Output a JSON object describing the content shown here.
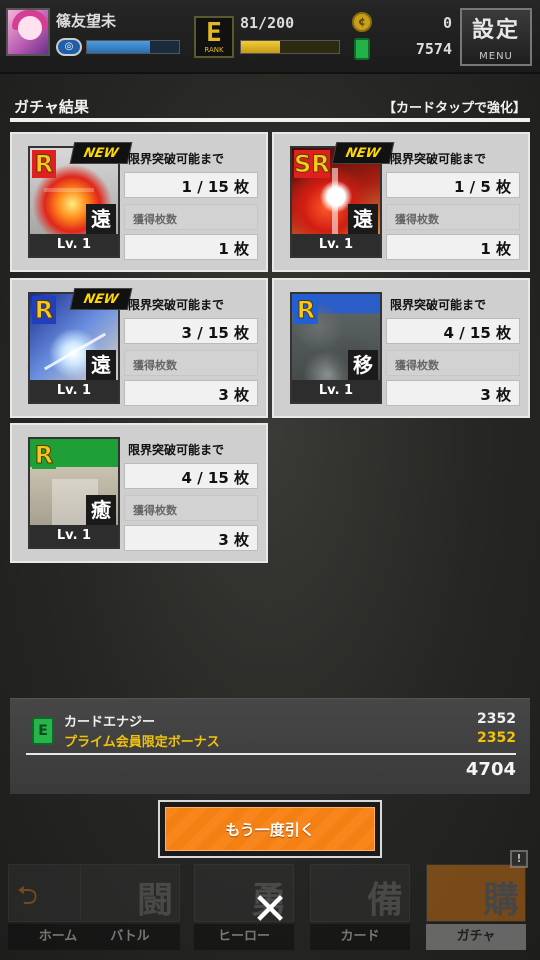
{
  "header": {
    "player_name": "篠友望未",
    "rank_letter": "E",
    "rank_label": "RANK",
    "stamina": "81/200",
    "stamina_fraction": 0.4,
    "exp_fraction": 0.68,
    "gems": "0",
    "energy": "7574",
    "settings_label": "設定",
    "settings_sub": "MENU"
  },
  "page": {
    "title": "ガチャ結果",
    "hint": "【カードタップで強化】"
  },
  "cards": [
    {
      "rarity": "R",
      "rarity_color": "#e02020",
      "new_label": "NEW",
      "type": "遠",
      "level": "Lv. 1",
      "limit_label": "限界突破可能まで",
      "limit_value": "1 / 15 枚",
      "owned_label": "獲得枚数",
      "owned_value": "1 枚"
    },
    {
      "rarity": "SR",
      "rarity_color": "#e02020",
      "new_label": "NEW",
      "type": "遠",
      "level": "Lv. 1",
      "limit_label": "限界突破可能まで",
      "limit_value": "1 / 5 枚",
      "owned_label": "獲得枚数",
      "owned_value": "1 枚"
    },
    {
      "rarity": "R",
      "rarity_color": "#1f3fbf",
      "new_label": "NEW",
      "type": "遠",
      "level": "Lv. 1",
      "limit_label": "限界突破可能まで",
      "limit_value": "3 / 15 枚",
      "owned_label": "獲得枚数",
      "owned_value": "3 枚"
    },
    {
      "rarity": "R",
      "rarity_color": "#1f5fd8",
      "new_label": "",
      "type": "移",
      "level": "Lv. 1",
      "limit_label": "限界突破可能まで",
      "limit_value": "4 / 15 枚",
      "owned_label": "獲得枚数",
      "owned_value": "3 枚"
    },
    {
      "rarity": "R",
      "rarity_color": "#1f9f37",
      "new_label": "",
      "type": "癒",
      "level": "Lv. 1",
      "limit_label": "限界突破可能まで",
      "limit_value": "4 / 15 枚",
      "owned_label": "獲得枚数",
      "owned_value": "3 枚"
    }
  ],
  "energy_summary": {
    "label": "カードエナジー",
    "amount": "2352",
    "bonus_label": "プライム会員限定ボーナス",
    "bonus_amount": "2352",
    "total": "4704",
    "accent_color": "#f0c20a"
  },
  "pull_again_label": "もう一度引く",
  "close_label": "✕",
  "bottom_nav": [
    {
      "label": "ホーム",
      "glyph": "⮌"
    },
    {
      "label": "バトル",
      "glyph": "闘"
    },
    {
      "label": "ヒーロー",
      "glyph": "勇"
    },
    {
      "label": "カード",
      "glyph": "備"
    },
    {
      "label": "ガチャ",
      "glyph": "購"
    }
  ],
  "nav_alert": "!"
}
